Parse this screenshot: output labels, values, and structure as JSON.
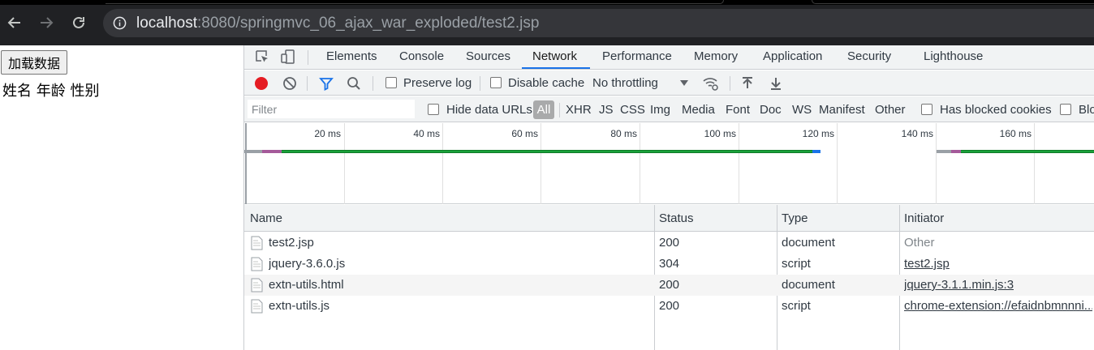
{
  "browser": {
    "url_host": "localhost",
    "url_rest": ":8080/springmvc_06_ajax_war_exploded/test2.jsp"
  },
  "page": {
    "load_button": "加载数据",
    "headers_text": "姓名 年龄 性别"
  },
  "devtools": {
    "tabs": [
      "Elements",
      "Console",
      "Sources",
      "Network",
      "Performance",
      "Memory",
      "Application",
      "Security",
      "Lighthouse"
    ],
    "active_tab": "Network",
    "toolbar": {
      "preserve_log": "Preserve log",
      "disable_cache": "Disable cache",
      "throttling": "No throttling"
    },
    "filter": {
      "placeholder": "Filter",
      "hide_data_urls": "Hide data URLs",
      "all": "All",
      "types": [
        "XHR",
        "JS",
        "CSS",
        "Img",
        "Media",
        "Font",
        "Doc",
        "WS",
        "Manifest",
        "Other"
      ],
      "has_blocked_cookies": "Has blocked cookies",
      "blocked_requests_truncated": "Blo"
    },
    "timeline_ticks": [
      "20 ms",
      "40 ms",
      "60 ms",
      "80 ms",
      "100 ms",
      "120 ms",
      "140 ms",
      "160 ms"
    ],
    "columns": {
      "name": "Name",
      "status": "Status",
      "type": "Type",
      "initiator": "Initiator"
    },
    "requests": [
      {
        "name": "test2.jsp",
        "status": "200",
        "type": "document",
        "initiator": "Other"
      },
      {
        "name": "jquery-3.6.0.js",
        "status": "304",
        "type": "script",
        "initiator": "test2.jsp"
      },
      {
        "name": "extn-utils.html",
        "status": "200",
        "type": "document",
        "initiator": "jquery-3.1.1.min.js:3"
      },
      {
        "name": "extn-utils.js",
        "status": "200",
        "type": "script",
        "initiator": "chrome-extension://efaidnbmnnni..."
      }
    ],
    "colors": {
      "record": "#e51c23",
      "active_underline": "#1a73e8",
      "filter_icon": "#1a73e8",
      "waterfall_green": "#1aa23a"
    }
  }
}
